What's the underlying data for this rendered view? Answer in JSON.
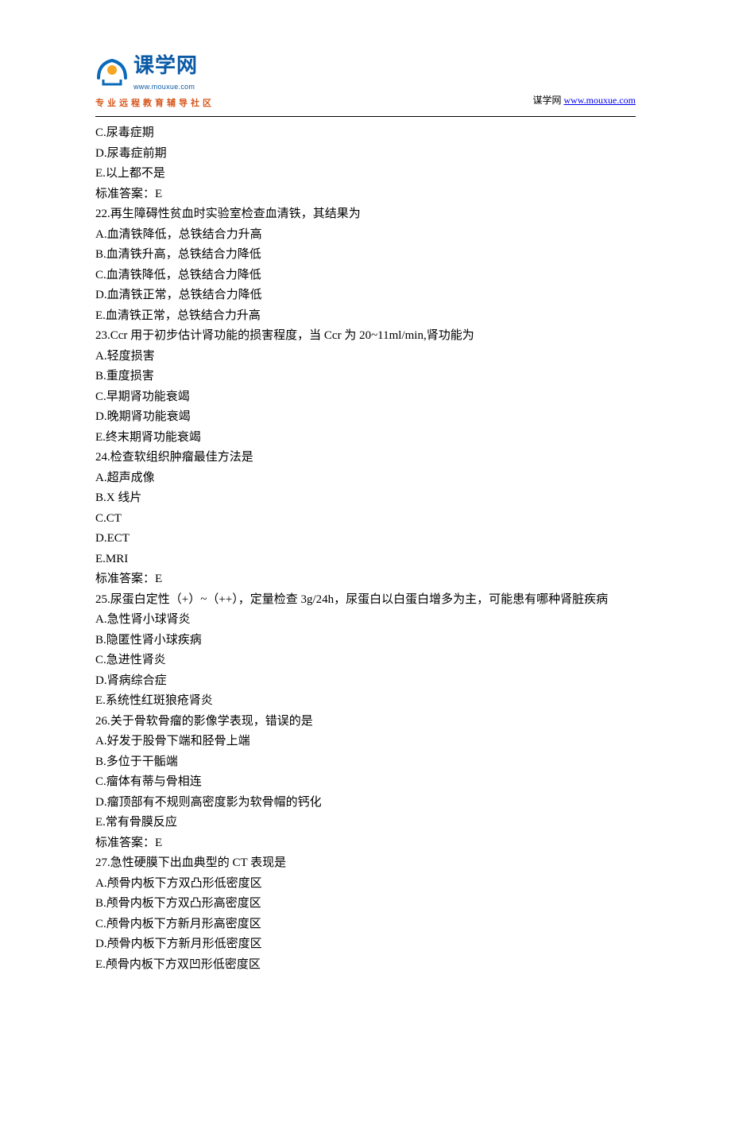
{
  "header": {
    "logo_cn": "课学网",
    "logo_en": "www.mouxue.com",
    "logo_tagline": "专业远程教育辅导社区",
    "site_label": "谋学网 ",
    "site_url": "www.mouxue.com"
  },
  "lines": [
    "C.尿毒症期",
    "D.尿毒症前期",
    "E.以上都不是",
    "标准答案：E",
    "22.再生障碍性贫血时实验室检查血清铁，其结果为",
    "A.血清铁降低，总铁结合力升高",
    "B.血清铁升高，总铁结合力降低",
    "C.血清铁降低，总铁结合力降低",
    "D.血清铁正常，总铁结合力降低",
    "E.血清铁正常，总铁结合力升高",
    "23.Ccr 用于初步估计肾功能的损害程度，当 Ccr 为 20~11ml/min,肾功能为",
    "A.轻度损害",
    "B.重度损害",
    "C.早期肾功能衰竭",
    "D.晚期肾功能衰竭",
    "E.终末期肾功能衰竭",
    "24.检查软组织肿瘤最佳方法是",
    "A.超声成像",
    "B.X 线片",
    "C.CT",
    "D.ECT",
    "E.MRI",
    "标准答案：E",
    "25.尿蛋白定性（+）~（++），定量检查 3g/24h，尿蛋白以白蛋白增多为主，可能患有哪种肾脏疾病",
    "A.急性肾小球肾炎",
    "B.隐匿性肾小球疾病",
    "C.急进性肾炎",
    "D.肾病综合症",
    "E.系统性红斑狼疮肾炎",
    "26.关于骨软骨瘤的影像学表现，错误的是",
    "A.好发于股骨下端和胫骨上端",
    "B.多位于干骺端",
    "C.瘤体有蒂与骨相连",
    "D.瘤顶部有不规则高密度影为软骨帽的钙化",
    "E.常有骨膜反应",
    "标准答案：E",
    "27.急性硬膜下出血典型的 CT 表现是",
    "A.颅骨内板下方双凸形低密度区",
    "B.颅骨内板下方双凸形高密度区",
    "C.颅骨内板下方新月形高密度区",
    "D.颅骨内板下方新月形低密度区",
    "E.颅骨内板下方双凹形低密度区"
  ]
}
